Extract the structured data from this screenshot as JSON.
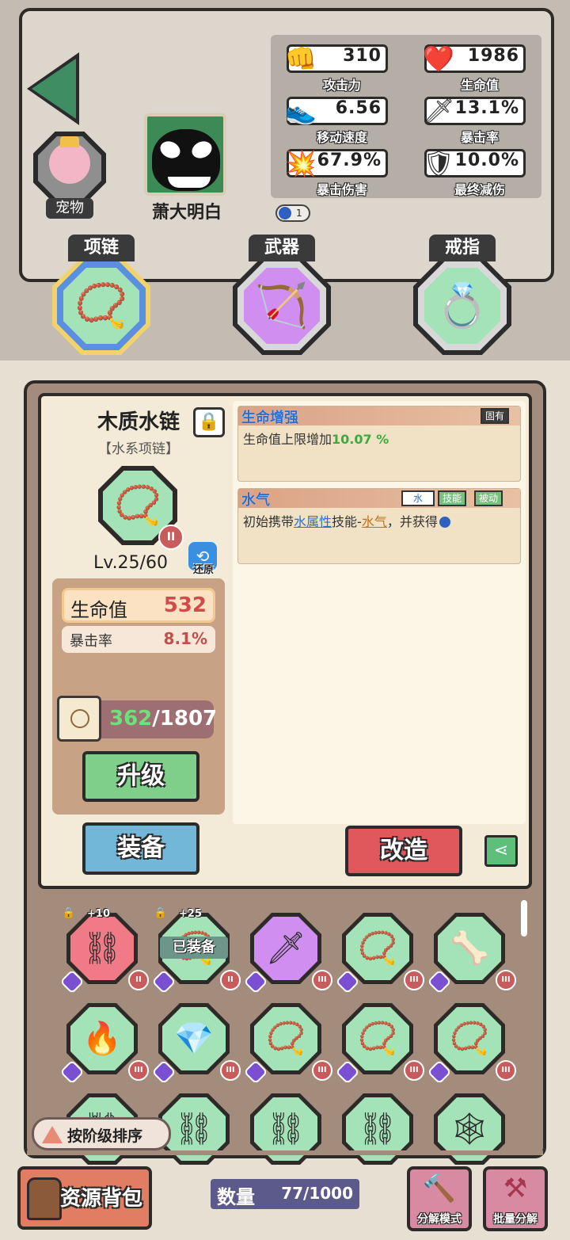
{
  "pet": {
    "label": "宠物",
    "icon": "fairy-pet-icon"
  },
  "player": {
    "name": "萧大明白",
    "icon": "venom-avatar-icon"
  },
  "stats": [
    {
      "value": "310",
      "label": "攻击力",
      "icon": "fist-icon"
    },
    {
      "value": "1986",
      "label": "生命值",
      "icon": "heart-icon"
    },
    {
      "value": "6.56",
      "label": "移动速度",
      "icon": "shoe-icon"
    },
    {
      "value": "13.1%",
      "label": "暴击率",
      "icon": "sword-icon"
    },
    {
      "value": "67.9%",
      "label": "暴击伤害",
      "icon": "explosion-icon"
    },
    {
      "value": "10.0%",
      "label": "最终减伤",
      "icon": "shield-icon"
    }
  ],
  "drop_badge": {
    "count": "1",
    "icon": "water-drop-icon"
  },
  "slots": [
    {
      "label": "项链",
      "icon": "necklace-icon",
      "selected": true
    },
    {
      "label": "武器",
      "icon": "bow-icon",
      "selected": false
    },
    {
      "label": "戒指",
      "icon": "diamond-ring-icon",
      "selected": false
    }
  ],
  "item": {
    "name": "木质水链",
    "subtitle": "【水系项链】",
    "tier": "II",
    "level": "Lv.25/60",
    "restore_label": "还原",
    "main_attr": {
      "label": "生命值",
      "value": "532"
    },
    "sub_attr": {
      "label": "暴击率",
      "value": "8.1%"
    },
    "exp_current": "362",
    "exp_total": "/1807",
    "upgrade_label": "升级",
    "equip_label": "装备",
    "reforge_label": "改造"
  },
  "affixes": [
    {
      "title": "生命增强",
      "tags": [
        "固有"
      ],
      "desc_prefix": "生命值上限增加",
      "desc_value": "10.07 %"
    },
    {
      "title": "水气",
      "tags": [
        "水",
        "技能",
        "被动"
      ],
      "desc_prefix": "初始携带",
      "desc_link1": "水属性",
      "desc_mid": "技能-",
      "desc_link2": "水气",
      "desc_suffix": "，并获得"
    }
  ],
  "inventory": [
    {
      "bg": "#f07a86",
      "glyph": "⛓",
      "tier": "II",
      "plus": "+10",
      "locked": true,
      "equipped": false
    },
    {
      "bg": "#a4e3b8",
      "glyph": "📿",
      "tier": "II",
      "plus": "+25",
      "locked": true,
      "equipped": true
    },
    {
      "bg": "#cf8ef0",
      "glyph": "🗡",
      "tier": "III",
      "plus": "",
      "locked": false,
      "equipped": false
    },
    {
      "bg": "#a4e3b8",
      "glyph": "📿",
      "tier": "III",
      "plus": "",
      "locked": false,
      "equipped": false
    },
    {
      "bg": "#a4e3b8",
      "glyph": "🦴",
      "tier": "III",
      "plus": "",
      "locked": false,
      "equipped": false
    },
    {
      "bg": "#a4e3b8",
      "glyph": "🔥",
      "tier": "III",
      "plus": "",
      "locked": false,
      "equipped": false
    },
    {
      "bg": "#a4e3b8",
      "glyph": "💎",
      "tier": "III",
      "plus": "",
      "locked": false,
      "equipped": false
    },
    {
      "bg": "#a4e3b8",
      "glyph": "📿",
      "tier": "III",
      "plus": "",
      "locked": false,
      "equipped": false
    },
    {
      "bg": "#a4e3b8",
      "glyph": "📿",
      "tier": "III",
      "plus": "",
      "locked": false,
      "equipped": false
    },
    {
      "bg": "#a4e3b8",
      "glyph": "📿",
      "tier": "III",
      "plus": "",
      "locked": false,
      "equipped": false
    },
    {
      "bg": "#a4e3b8",
      "glyph": "⛓",
      "tier": "",
      "plus": "",
      "locked": false,
      "equipped": false
    },
    {
      "bg": "#a4e3b8",
      "glyph": "⛓",
      "tier": "",
      "plus": "",
      "locked": false,
      "equipped": false
    },
    {
      "bg": "#a4e3b8",
      "glyph": "⛓",
      "tier": "",
      "plus": "",
      "locked": false,
      "equipped": false
    },
    {
      "bg": "#a4e3b8",
      "glyph": "⛓",
      "tier": "",
      "plus": "",
      "locked": false,
      "equipped": false
    },
    {
      "bg": "#a4e3b8",
      "glyph": "🕸",
      "tier": "",
      "plus": "",
      "locked": false,
      "equipped": false
    }
  ],
  "equipped_label": "已装备",
  "sort_label": "按阶级排序",
  "bag_label": "资源背包",
  "count": {
    "label": "数量",
    "value": "77/1000"
  },
  "tools": [
    {
      "label": "分解模式",
      "icon": "hammer-icon"
    },
    {
      "label": "批量分解",
      "icon": "anvil-icon"
    }
  ]
}
